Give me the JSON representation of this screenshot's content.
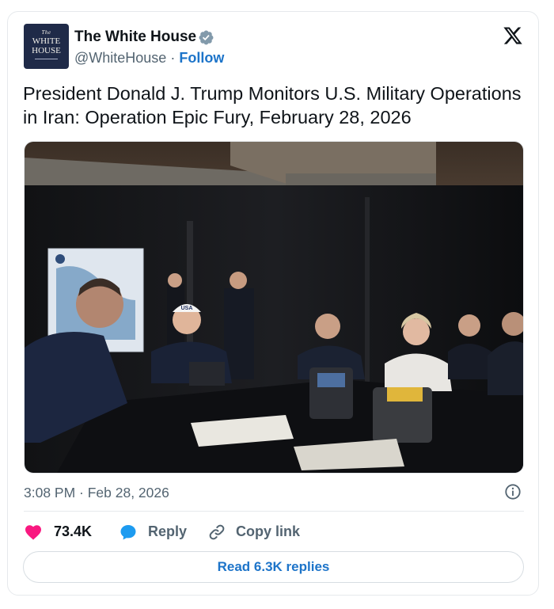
{
  "account": {
    "avatar_line1": "The",
    "avatar_line2": "WHITE",
    "avatar_line3": "HOUSE",
    "name": "The White House",
    "handle": "@WhiteHouse",
    "separator": "·",
    "follow_label": "Follow",
    "verified_icon": "verified-badge-gray"
  },
  "tweet": {
    "text": "President Donald J. Trump Monitors U.S. Military Operations in Iran: Operation Epic Fury, February 28, 2026",
    "timestamp": "3:08 PM · Feb 28, 2026",
    "photo_cap_text": "USA"
  },
  "actions": {
    "like_count": "73.4K",
    "reply_label": "Reply",
    "copy_label": "Copy link",
    "read_replies_label": "Read 6.3K replies"
  },
  "colors": {
    "link_blue": "#1d74c9",
    "like_red": "#f91880",
    "reply_blue": "#1d9bf0",
    "secondary_text": "#536471"
  }
}
